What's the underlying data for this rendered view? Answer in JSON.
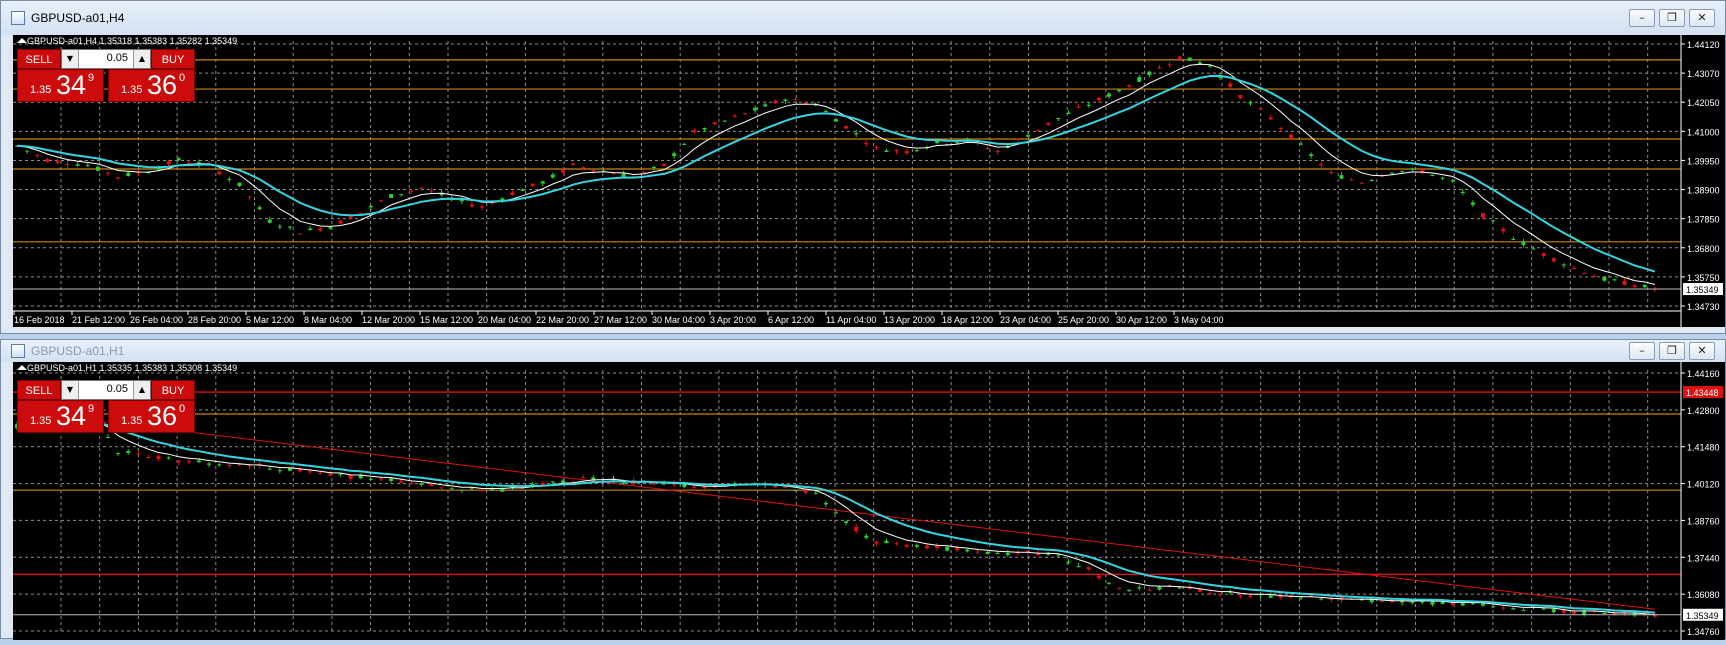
{
  "windows": [
    {
      "title": "GBPUSD-a01,H4",
      "active": true,
      "info_symbol": "GBPUSD-a01,H4",
      "ohlc": "1.35318 1.35383 1.35282 1.35349",
      "trade": {
        "sell_label": "SELL",
        "buy_label": "BUY",
        "lot": "0.05",
        "sell_small": "1.35",
        "sell_big": "34",
        "sell_sup": "9",
        "buy_small": "1.35",
        "buy_big": "36",
        "buy_sup": "0"
      },
      "price_labels": [
        "1.44120",
        "1.43070",
        "1.42050",
        "1.41000",
        "1.39950",
        "1.38900",
        "1.37850",
        "1.36800",
        "1.35750",
        "1.34730"
      ],
      "current_price_label": "1.35349",
      "time_labels": [
        "16 Feb 2018",
        "21 Feb 12:00",
        "26 Feb 04:00",
        "28 Feb 20:00",
        "5 Mar 12:00",
        "8 Mar 04:00",
        "12 Mar 20:00",
        "15 Mar 12:00",
        "20 Mar 04:00",
        "22 Mar 20:00",
        "27 Mar 12:00",
        "30 Mar 04:00",
        "3 Apr 20:00",
        "6 Apr 12:00",
        "11 Apr 04:00",
        "13 Apr 20:00",
        "18 Apr 12:00",
        "23 Apr 04:00",
        "25 Apr 20:00",
        "30 Apr 12:00",
        "3 May 04:00"
      ],
      "horizontal_levels": [
        1.436,
        1.4255,
        1.4075,
        1.3967,
        1.3705
      ],
      "level_color": "#c8860a",
      "y_range": [
        1.3463,
        1.4428
      ],
      "price_path": [
        [
          0,
          1.405
        ],
        [
          3,
          1.4
        ],
        [
          7,
          1.398
        ],
        [
          10,
          1.394
        ],
        [
          13,
          1.396
        ],
        [
          16,
          1.4
        ],
        [
          19,
          1.398
        ],
        [
          22,
          1.391
        ],
        [
          25,
          1.378
        ],
        [
          28,
          1.374
        ],
        [
          31,
          1.376
        ],
        [
          34,
          1.381
        ],
        [
          37,
          1.387
        ],
        [
          40,
          1.39
        ],
        [
          43,
          1.386
        ],
        [
          46,
          1.383
        ],
        [
          49,
          1.388
        ],
        [
          52,
          1.392
        ],
        [
          55,
          1.398
        ],
        [
          58,
          1.396
        ],
        [
          61,
          1.394
        ],
        [
          64,
          1.398
        ],
        [
          67,
          1.41
        ],
        [
          70,
          1.414
        ],
        [
          73,
          1.418
        ],
        [
          76,
          1.422
        ],
        [
          79,
          1.42
        ],
        [
          82,
          1.412
        ],
        [
          85,
          1.404
        ],
        [
          88,
          1.403
        ],
        [
          91,
          1.406
        ],
        [
          94,
          1.407
        ],
        [
          97,
          1.403
        ],
        [
          100,
          1.409
        ],
        [
          103,
          1.415
        ],
        [
          106,
          1.42
        ],
        [
          109,
          1.425
        ],
        [
          112,
          1.431
        ],
        [
          115,
          1.437
        ],
        [
          118,
          1.434
        ],
        [
          121,
          1.423
        ],
        [
          124,
          1.415
        ],
        [
          127,
          1.405
        ],
        [
          130,
          1.395
        ],
        [
          133,
          1.392
        ],
        [
          136,
          1.396
        ],
        [
          139,
          1.396
        ],
        [
          142,
          1.392
        ],
        [
          145,
          1.38
        ],
        [
          148,
          1.372
        ],
        [
          151,
          1.366
        ],
        [
          154,
          1.361
        ],
        [
          157,
          1.357
        ],
        [
          160,
          1.355
        ],
        [
          162,
          1.3535
        ]
      ]
    },
    {
      "title": "GBPUSD-a01,H1",
      "active": false,
      "info_symbol": "GBPUSD-a01,H1",
      "ohlc": "1.35335 1.35383 1.35308 1.35349",
      "trade": {
        "sell_label": "SELL",
        "buy_label": "BUY",
        "lot": "0.05",
        "sell_small": "1.35",
        "sell_big": "34",
        "sell_sup": "9",
        "buy_small": "1.35",
        "buy_big": "36",
        "buy_sup": "0"
      },
      "price_labels": [
        "1.44160",
        "1.42800",
        "1.41480",
        "1.40120",
        "1.38760",
        "1.37440",
        "1.36080",
        "1.34760"
      ],
      "current_price_label": "1.35349",
      "red_level_label": "1.43448",
      "red_levels": [
        1.43448,
        1.3682
      ],
      "horizontal_levels": [
        1.4265,
        1.3988
      ],
      "level_color": "#c8860a",
      "red_color": "#e01010",
      "y_range": [
        1.3465,
        1.4425
      ],
      "trend_line": [
        [
          0,
          1.4275
        ],
        [
          162,
          1.3555
        ]
      ],
      "price_path": [
        [
          0,
          1.422
        ],
        [
          3,
          1.422
        ],
        [
          6,
          1.424
        ],
        [
          8,
          1.423
        ],
        [
          10,
          1.413
        ],
        [
          13,
          1.411
        ],
        [
          16,
          1.4095
        ],
        [
          20,
          1.4085
        ],
        [
          24,
          1.4075
        ],
        [
          28,
          1.406
        ],
        [
          32,
          1.404
        ],
        [
          36,
          1.403
        ],
        [
          40,
          1.401
        ],
        [
          44,
          1.3995
        ],
        [
          48,
          1.399
        ],
        [
          52,
          1.401
        ],
        [
          56,
          1.403
        ],
        [
          60,
          1.402
        ],
        [
          64,
          1.401
        ],
        [
          68,
          1.4
        ],
        [
          72,
          1.401
        ],
        [
          76,
          1.4
        ],
        [
          79,
          1.398
        ],
        [
          82,
          1.387
        ],
        [
          85,
          1.38
        ],
        [
          88,
          1.379
        ],
        [
          91,
          1.378
        ],
        [
          94,
          1.377
        ],
        [
          97,
          1.376
        ],
        [
          100,
          1.376
        ],
        [
          103,
          1.375
        ],
        [
          106,
          1.37
        ],
        [
          109,
          1.363
        ],
        [
          112,
          1.3625
        ],
        [
          115,
          1.364
        ],
        [
          118,
          1.362
        ],
        [
          121,
          1.361
        ],
        [
          124,
          1.3605
        ],
        [
          127,
          1.36
        ],
        [
          130,
          1.3595
        ],
        [
          133,
          1.359
        ],
        [
          136,
          1.3585
        ],
        [
          139,
          1.358
        ],
        [
          142,
          1.3575
        ],
        [
          145,
          1.357
        ],
        [
          148,
          1.356
        ],
        [
          151,
          1.3555
        ],
        [
          154,
          1.3545
        ],
        [
          157,
          1.354
        ],
        [
          160,
          1.3538
        ],
        [
          162,
          1.3535
        ]
      ]
    }
  ],
  "colors": {
    "candle_up": "#2bd12b",
    "candle_down": "#e01010",
    "ma_fast": "#ffffff",
    "ma_slow": "#33d6e0",
    "grid": "#8c8c8c",
    "axis_text": "#ffffff"
  }
}
